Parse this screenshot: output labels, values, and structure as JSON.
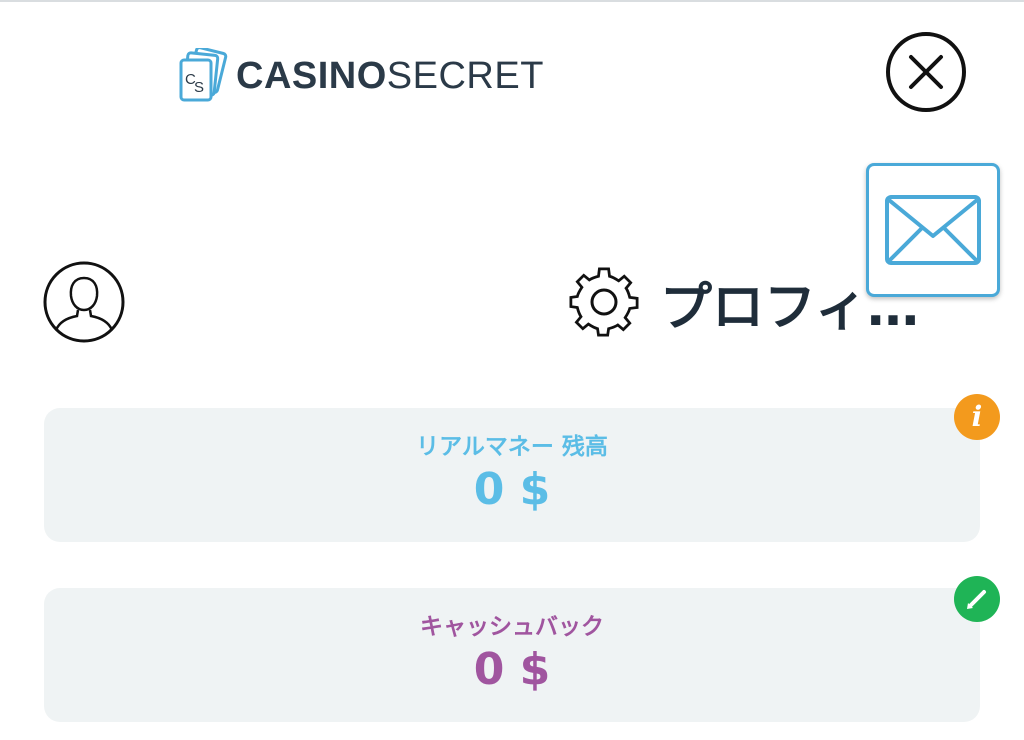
{
  "header": {
    "brand_bold": "CASINO",
    "brand_light": "SECRET"
  },
  "profile": {
    "title": "プロフィ…"
  },
  "cards": {
    "real_money": {
      "label": "リアルマネー 残高",
      "value": "0 $"
    },
    "cashback": {
      "label": "キャッシュバック",
      "value": "0 $"
    }
  },
  "badges": {
    "info_glyph": "i"
  },
  "colors": {
    "brand_text": "#2b3a48",
    "accent_blue": "#4aa9d8",
    "real_money": "#5bbde6",
    "cashback": "#a0559f",
    "info_badge": "#f39a1d",
    "edit_badge": "#1fb456",
    "card_bg": "#eff3f4"
  },
  "icons": [
    "logo-cards-icon",
    "close-icon",
    "mail-icon",
    "user-avatar-icon",
    "gear-icon",
    "info-icon",
    "edit-icon"
  ]
}
